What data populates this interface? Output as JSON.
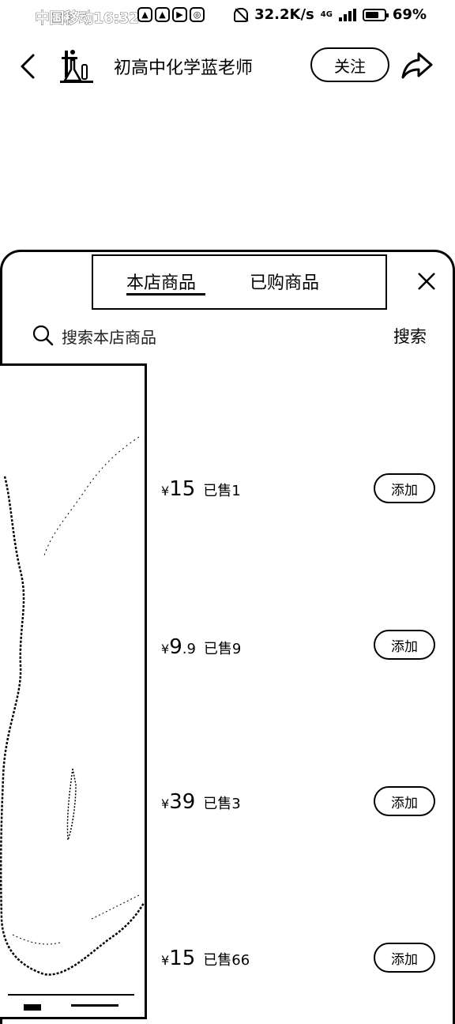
{
  "status_bar": {
    "carrier_time": "中国移动16:32",
    "speed": "32.2K/s",
    "network": "4G",
    "battery": "69%"
  },
  "header": {
    "shop_name": "初高中化学蓝老师",
    "follow_label": "关注"
  },
  "tabs": [
    {
      "label": "本店商品",
      "active": true
    },
    {
      "label": "已购商品",
      "active": false
    }
  ],
  "search": {
    "placeholder": "搜索本店商品",
    "button": "搜索"
  },
  "products": [
    {
      "title": "",
      "price_int": "15",
      "price_dec": "",
      "sold": "已售1",
      "add_label": "添加"
    },
    {
      "title": "",
      "price_int": "9",
      "price_dec": ".9",
      "sold": "已售9",
      "add_label": "添加"
    },
    {
      "title": "",
      "price_int": "39",
      "price_dec": "",
      "sold": "已售3",
      "add_label": "添加"
    },
    {
      "title": "",
      "price_int": "15",
      "price_dec": "",
      "sold": "已售66",
      "add_label": "添加"
    }
  ],
  "currency": "¥"
}
